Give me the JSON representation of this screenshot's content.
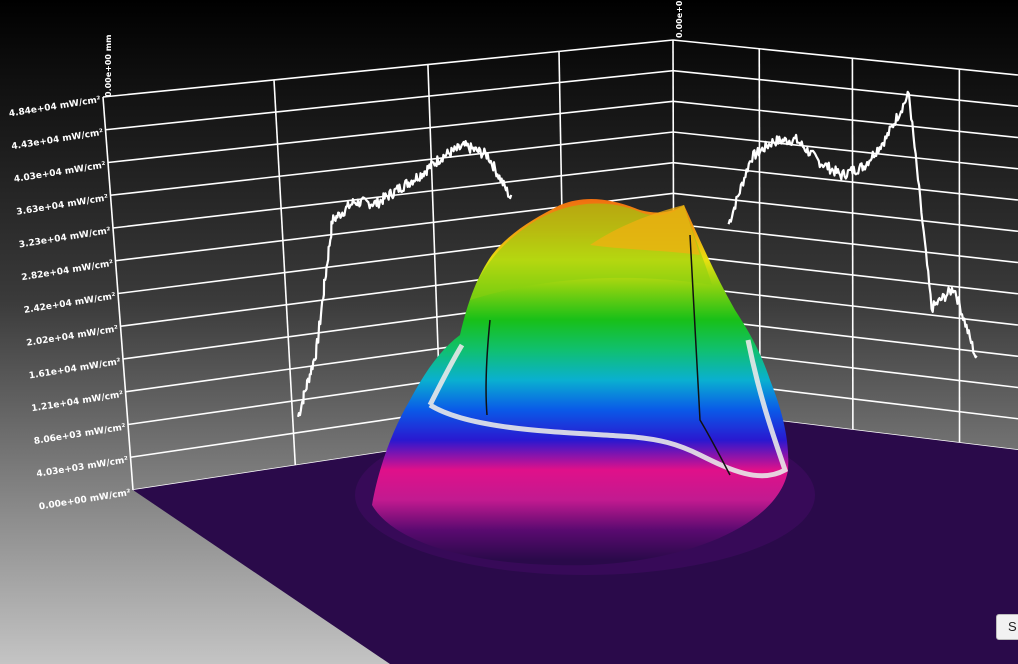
{
  "chart_data": {
    "type": "surface3d",
    "z_unit": "mW/cm²",
    "z_ticks": [
      "0.00e+00 mW/cm²",
      "4.03e+03 mW/cm²",
      "8.06e+03 mW/cm²",
      "1.21e+04 mW/cm²",
      "1.61e+04 mW/cm²",
      "2.02e+04 mW/cm²",
      "2.42e+04 mW/cm²",
      "2.82e+04 mW/cm²",
      "3.23e+04 mW/cm²",
      "3.63e+04 mW/cm²",
      "4.03e+04 mW/cm²",
      "4.43e+04 mW/cm²",
      "4.84e+04 mW/cm²"
    ],
    "zlim": [
      0,
      48400
    ],
    "x_axis_label": "0.00e+00 mm",
    "y_axis_label": "0.00e+0",
    "grid": true,
    "colormap": [
      "#2a0a4a",
      "#5a0a70",
      "#c21a90",
      "#e0108a",
      "#2a18d0",
      "#0a5ae8",
      "#0ab0d0",
      "#10c070",
      "#18c018",
      "#80d010",
      "#e8e010",
      "#f0a010",
      "#f07010"
    ],
    "profile_x": {
      "name": "",
      "values": [
        6000,
        14000,
        30000,
        32000,
        31500,
        33000,
        34500,
        36500,
        37500,
        36000,
        30000
      ]
    },
    "profile_y": {
      "name": "",
      "values": [
        25000,
        34000,
        36500,
        37000,
        34500,
        33000,
        34500,
        38500,
        44500,
        17000,
        20000,
        11000
      ]
    }
  },
  "ui": {
    "corner_button_label": "S"
  }
}
